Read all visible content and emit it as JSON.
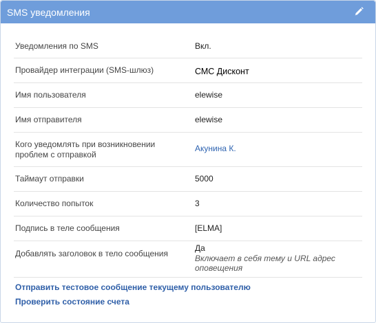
{
  "panel": {
    "title": "SMS уведомления",
    "edit_icon": "pencil-icon",
    "header_color": "#6f9ddb"
  },
  "settings": [
    {
      "label": "Уведомления по SMS",
      "value": "Вкл."
    },
    {
      "label": "Провайдер интеграции (SMS-шлюз)",
      "value": "СМС Дисконт"
    },
    {
      "label": "Имя пользователя",
      "value": "elewise"
    },
    {
      "label": "Имя отправителя",
      "value": "elewise"
    },
    {
      "label": "Кого уведомлять при возникновении проблем с отправкой",
      "value": "Акунина К."
    },
    {
      "label": "Таймаут отправки",
      "value": "5000"
    },
    {
      "label": "Количество попыток",
      "value": "3"
    },
    {
      "label": "Подпись в теле сообщения",
      "value": "[ELMA]"
    },
    {
      "label": "Добавлять заголовок в тело сообщения",
      "value": "Да",
      "hint": "Включает в себя тему и URL адрес оповещения"
    }
  ],
  "actions": {
    "send_test": "Отправить тестовое сообщение текущему пользователю",
    "check_balance": "Проверить состояние счета"
  },
  "colors": {
    "link": "#2e63b0",
    "action_link": "#2f5fa8",
    "row_border": "#e3e3e3"
  }
}
